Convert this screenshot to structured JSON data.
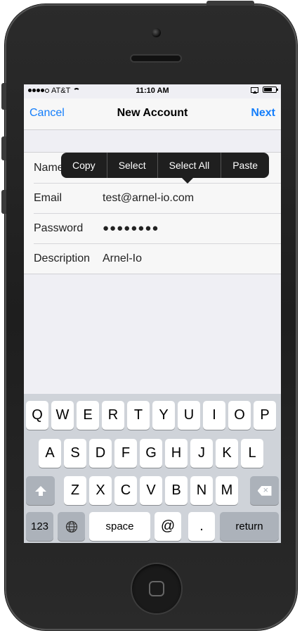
{
  "status": {
    "carrier": "AT&T",
    "time": "11:10 AM",
    "signal_bars": 4,
    "battery_level": 0.7
  },
  "nav": {
    "cancel": "Cancel",
    "title": "New Account",
    "next": "Next"
  },
  "form": {
    "rows": [
      {
        "label": "Name",
        "value": ""
      },
      {
        "label": "Email",
        "value": "test@arnel-io.com"
      },
      {
        "label": "Password",
        "value": "●●●●●●●●"
      },
      {
        "label": "Description",
        "value": "Arnel-Io"
      }
    ]
  },
  "edit_menu": {
    "items": [
      "Copy",
      "Select",
      "Select All",
      "Paste"
    ]
  },
  "keyboard": {
    "row1": [
      "Q",
      "W",
      "E",
      "R",
      "T",
      "Y",
      "U",
      "I",
      "O",
      "P"
    ],
    "row2": [
      "A",
      "S",
      "D",
      "F",
      "G",
      "H",
      "J",
      "K",
      "L"
    ],
    "row3": [
      "Z",
      "X",
      "C",
      "V",
      "B",
      "N",
      "M"
    ],
    "numbers": "123",
    "space": "space",
    "at": "@",
    "period": ".",
    "return": "return"
  },
  "colors": {
    "accent": "#147efb",
    "keyboard_bg": "#cfd3d9",
    "menu_bg": "#1f1f1f"
  }
}
